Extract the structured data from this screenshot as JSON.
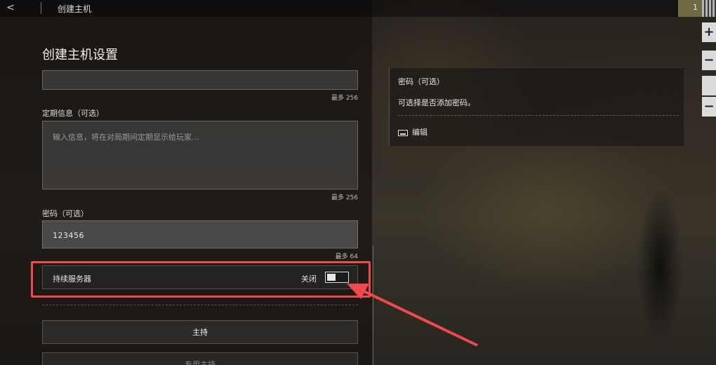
{
  "header": {
    "title": "创建主机",
    "badge": "1"
  },
  "page": {
    "heading": "创建主机设置"
  },
  "fields": {
    "top_field_limit": "最多 256",
    "periodic_info": {
      "label": "定期信息（可选）",
      "placeholder": "输入信息，将在对局期间定期显示给玩家...",
      "limit": "最多 256"
    },
    "password": {
      "label": "密码（可选）",
      "value": "123456",
      "limit": "最多 64"
    }
  },
  "persistent_server": {
    "label": "持续服务器",
    "state": "关闭",
    "enabled": false
  },
  "buttons": {
    "host": "主持",
    "second": "专用主持"
  },
  "info_panel": {
    "title": "密码（可选）",
    "description": "可选择是否添加密码。",
    "edit_label": "编辑"
  },
  "edge_controls": [
    "+",
    "−",
    "",
    "−"
  ],
  "colors": {
    "highlight": "#f04a4a"
  }
}
